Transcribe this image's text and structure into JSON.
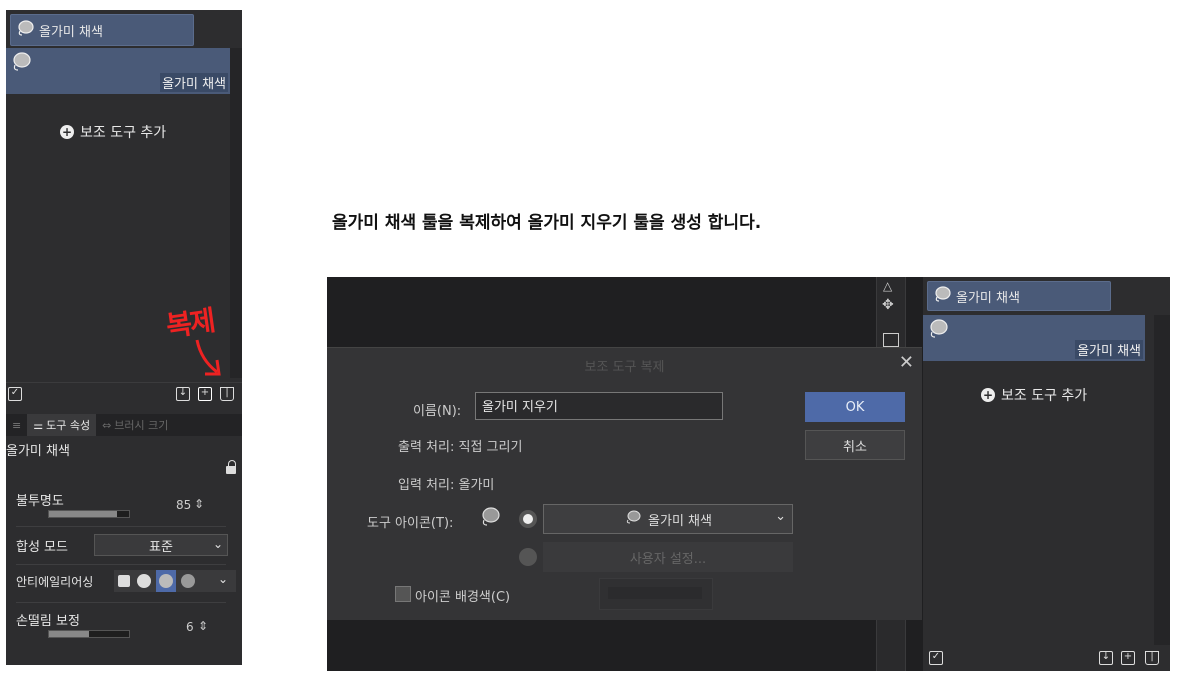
{
  "left_panel": {
    "tab_label": "올가미 채색",
    "subtool_label": "올가미 채색",
    "add_subtool": "보조 도구 추가",
    "annotation": "복제",
    "prop_tabs": [
      "도구 속성",
      "브러시 크기"
    ],
    "tool_name": "올가미 채색",
    "opacity_label": "불투명도",
    "opacity_value": "85",
    "opacity_level": 0.85,
    "blend_label": "합성 모드",
    "blend_value": "표준",
    "antialias_label": "안티에일리어싱",
    "stabilize_label": "손떨림 보정",
    "stabilize_value": "6"
  },
  "instruction": "올가미 채색 툴을 복제하여 올가미 지우기 툴을 생성 합니다.",
  "dialog": {
    "title": "보조 도구 복제",
    "name_label": "이름(N):",
    "name_value": "올가미 지우기",
    "output_label": "출력 처리: 직접 그리기",
    "input_label": "입력 처리: 올가미",
    "icon_label": "도구 아이콘(T):",
    "icon_select": "올가미 채색",
    "custom_label": "사용자 설정...",
    "bg_color_label": "아이콘 배경색(C)",
    "ok": "OK",
    "cancel": "취소"
  },
  "right_panel": {
    "tab_label": "올가미 채색",
    "subtool_label": "올가미 채색",
    "add_subtool": "보조 도구 추가"
  },
  "colors": {
    "panel_bg": "#2d2d2f",
    "selected_bg": "#4a5a78",
    "ok_button": "#4e6aa8",
    "annotation": "#e22222"
  }
}
